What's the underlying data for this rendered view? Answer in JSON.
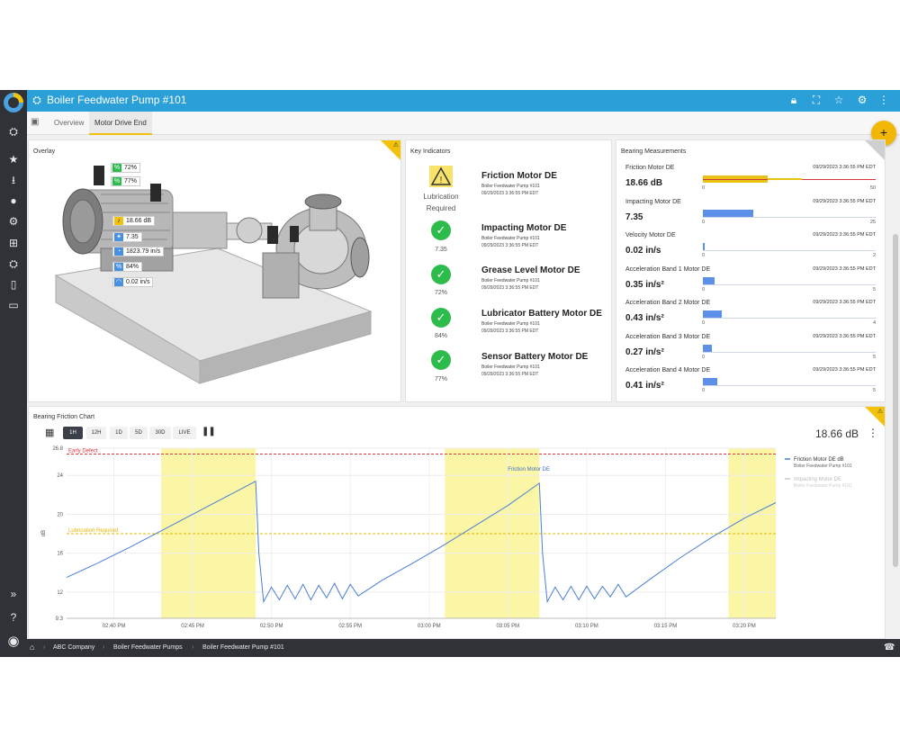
{
  "app": {
    "title": "Boiler Feedwater Pump #101",
    "tabs": [
      {
        "label": "Overview",
        "active": false
      },
      {
        "label": "Motor Drive End",
        "active": true
      }
    ],
    "fab_label": "+",
    "accent": "#2a9fd8",
    "warning_color": "#f2c20a"
  },
  "rail": {
    "top_icons": [
      "pump-icon",
      "star-icon",
      "download-icon",
      "user-icon",
      "gear-icon",
      "hierarchy-icon",
      "asset-icon",
      "mobile-icon",
      "report-icon"
    ],
    "bottom_icons": [
      "expand-icon",
      "help-icon",
      "account-icon"
    ]
  },
  "topbar_icons": [
    "lock-icon",
    "fullscreen-icon",
    "star-outline-icon",
    "settings-icon",
    "more-icon"
  ],
  "overlay": {
    "title": "Overlay",
    "tags": [
      {
        "icon": "percent-icon",
        "color": "#2cbc4b",
        "value": "72%"
      },
      {
        "icon": "percent-icon",
        "color": "#2cbc4b",
        "value": "77%"
      },
      {
        "icon": "volume-icon",
        "color": "#f2c20a",
        "value": "18.66 dB"
      },
      {
        "icon": "impact-icon",
        "color": "#4a90e2",
        "value": "7.35"
      },
      {
        "icon": "gauge-icon",
        "color": "#4a90e2",
        "value": "1823.79 in/s"
      },
      {
        "icon": "percent-icon",
        "color": "#4a90e2",
        "value": "84%"
      },
      {
        "icon": "speed-icon",
        "color": "#4a90e2",
        "value": "0.02 in/s"
      }
    ]
  },
  "key_indicators": {
    "title": "Key Indicators",
    "items": [
      {
        "status": "warning",
        "status_text_1": "Lubrication",
        "status_text_2": "Required",
        "name": "Friction Motor DE",
        "asset": "Boiler Feedwater Pump #101",
        "time": "09/29/2023 3:36:55 PM EDT"
      },
      {
        "status": "ok",
        "value": "7.35",
        "name": "Impacting Motor DE",
        "asset": "Boiler Feedwater Pump #101",
        "time": "09/29/2023 3:36:55 PM EDT"
      },
      {
        "status": "ok",
        "value": "72%",
        "name": "Grease Level Motor DE",
        "asset": "Boiler Feedwater Pump #101",
        "time": "09/29/2023 3:36:55 PM EDT"
      },
      {
        "status": "ok",
        "value": "84%",
        "name": "Lubricator Battery Motor DE",
        "asset": "Boiler Feedwater Pump #101",
        "time": "09/29/2023 3:36:55 PM EDT"
      },
      {
        "status": "ok",
        "value": "77%",
        "name": "Sensor Battery Motor DE",
        "asset": "Boiler Feedwater Pump #101",
        "time": "09/29/2023 3:36:55 PM EDT"
      }
    ]
  },
  "bearing": {
    "title": "Bearing Measurements",
    "items": [
      {
        "name": "Friction Motor DE",
        "value": "18.66 dB",
        "time": "09/29/2023 3:36:55 PM EDT",
        "min": "0",
        "max": "50",
        "fill": 0.373,
        "color": "#e6c213",
        "warn": true
      },
      {
        "name": "Impacting Motor DE",
        "value": "7.35",
        "time": "09/29/2023 3:36:55 PM EDT",
        "min": "0",
        "max": "25",
        "fill": 0.294,
        "color": "#5b8fe8",
        "warn": false
      },
      {
        "name": "Velocity Motor DE",
        "value": "0.02 in/s",
        "time": "09/29/2023 3:36:55 PM EDT",
        "min": "0",
        "max": "2",
        "fill": 0.01,
        "color": "#5b8fe8",
        "warn": false
      },
      {
        "name": "Acceleration Band 1 Motor DE",
        "value": "0.35 in/s²",
        "time": "09/29/2023 3:36:55 PM EDT",
        "min": "0",
        "max": "5",
        "fill": 0.07,
        "color": "#5b8fe8",
        "warn": false
      },
      {
        "name": "Acceleration Band 2 Motor DE",
        "value": "0.43 in/s²",
        "time": "09/29/2023 3:36:55 PM EDT",
        "min": "0",
        "max": "4",
        "fill": 0.1075,
        "color": "#5b8fe8",
        "warn": false
      },
      {
        "name": "Acceleration Band 3 Motor DE",
        "value": "0.27 in/s²",
        "time": "09/29/2023 3:36:55 PM EDT",
        "min": "0",
        "max": "5",
        "fill": 0.054,
        "color": "#5b8fe8",
        "warn": false
      },
      {
        "name": "Acceleration Band 4 Motor DE",
        "value": "0.41 in/s²",
        "time": "09/29/2023 3:36:55 PM EDT",
        "min": "0",
        "max": "5",
        "fill": 0.082,
        "color": "#5b8fe8",
        "warn": false
      }
    ]
  },
  "friction_chart_panel": {
    "title": "Bearing Friction Chart",
    "buttons": [
      {
        "label": "1H",
        "selected": true
      },
      {
        "label": "12H",
        "selected": false
      },
      {
        "label": "1D",
        "selected": false
      },
      {
        "label": "5D",
        "selected": false
      },
      {
        "label": "30D",
        "selected": false
      },
      {
        "label": "LIVE",
        "selected": false
      }
    ],
    "current_value": "18.66 dB"
  },
  "chart_data": {
    "type": "line",
    "title": "",
    "xlabel": "",
    "ylabel": "dB",
    "x_range": [
      "14:37",
      "15:22"
    ],
    "y_range": [
      9.3,
      26.8
    ],
    "y_ticks": [
      {
        "value": 26.8,
        "label": "26.8"
      },
      {
        "value": 24,
        "label": "24"
      },
      {
        "value": 20,
        "label": "20"
      },
      {
        "value": 16,
        "label": "16"
      },
      {
        "value": 12,
        "label": "12"
      },
      {
        "value": 9.3,
        "label": "9.3"
      }
    ],
    "x_ticks": [
      "14:40",
      "14:45",
      "14:50",
      "14:55",
      "15:00",
      "15:05",
      "15:10",
      "15:15",
      "15:20"
    ],
    "x_tick_labels": [
      "02:40 PM",
      "02:45 PM",
      "02:50 PM",
      "02:55 PM",
      "03:00 PM",
      "03:05 PM",
      "03:10 PM",
      "03:15 PM",
      "03:20 PM"
    ],
    "grid": true,
    "legend": "right",
    "thresholds": [
      {
        "label": "Early Defect",
        "value": 26.2,
        "color": "#d9363e"
      },
      {
        "label": "Lubrication Required",
        "value": 18.0,
        "color": "#e6b800"
      }
    ],
    "highlight_bands": [
      [
        "14:43",
        "14:49"
      ],
      [
        "15:01",
        "15:07"
      ],
      [
        "15:19",
        "15:22"
      ]
    ],
    "annotation": {
      "text": "Friction Motor DE",
      "x": "15:05",
      "y": 24.1
    },
    "series": [
      {
        "name": "Friction Motor DE dB",
        "subtitle": "Boiler Feedwater Pump #101",
        "color": "#4a7fd4",
        "visible": true,
        "points": [
          [
            "14:37",
            13.5
          ],
          [
            "14:39",
            15.0
          ],
          [
            "14:41",
            16.6
          ],
          [
            "14:43",
            18.3
          ],
          [
            "14:45",
            20.0
          ],
          [
            "14:47",
            21.7
          ],
          [
            "14:49",
            23.4
          ],
          [
            "14:49.2",
            16.0
          ],
          [
            "14:49.5",
            11.0
          ],
          [
            "14:50",
            12.5
          ],
          [
            "14:50.5",
            11.2
          ],
          [
            "14:51",
            12.7
          ],
          [
            "14:51.5",
            11.3
          ],
          [
            "14:52",
            12.8
          ],
          [
            "14:52.5",
            11.2
          ],
          [
            "14:53",
            12.7
          ],
          [
            "14:53.5",
            11.4
          ],
          [
            "14:54",
            12.9
          ],
          [
            "14:54.5",
            11.3
          ],
          [
            "14:55",
            12.8
          ],
          [
            "14:55.5",
            11.6
          ],
          [
            "14:57",
            13.2
          ],
          [
            "14:59",
            15.0
          ],
          [
            "15:01",
            16.9
          ],
          [
            "15:03",
            18.9
          ],
          [
            "15:05",
            20.9
          ],
          [
            "15:07",
            23.2
          ],
          [
            "15:07.2",
            16.0
          ],
          [
            "15:07.5",
            11.0
          ],
          [
            "15:08",
            12.5
          ],
          [
            "15:08.5",
            11.2
          ],
          [
            "15:09",
            12.6
          ],
          [
            "15:09.5",
            11.2
          ],
          [
            "15:10",
            12.6
          ],
          [
            "15:10.5",
            11.3
          ],
          [
            "15:11",
            12.6
          ],
          [
            "15:11.5",
            11.5
          ],
          [
            "15:12",
            12.8
          ],
          [
            "15:12.5",
            11.5
          ],
          [
            "15:14",
            13.3
          ],
          [
            "15:16",
            15.6
          ],
          [
            "15:18",
            17.7
          ],
          [
            "15:20",
            19.6
          ],
          [
            "15:22",
            21.2
          ]
        ]
      },
      {
        "name": "Impacting Motor DE",
        "subtitle": "Boiler Feedwater Pump #101",
        "color": "#c8c8c8",
        "visible": false,
        "points": []
      }
    ]
  },
  "breadcrumb": [
    "ABC Company",
    "Boiler Feedwater Pumps",
    "Boiler Feedwater Pump #101"
  ]
}
